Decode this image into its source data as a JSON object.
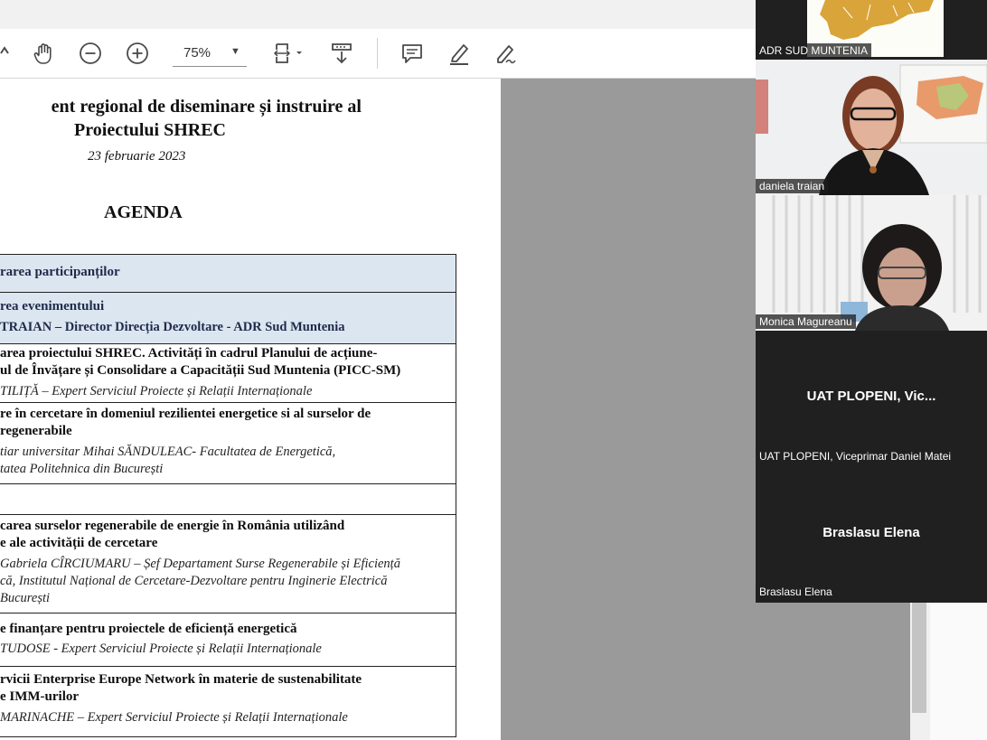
{
  "toolbar": {
    "zoom_value": "75%",
    "buttons": [
      "hand-tool-icon",
      "zoom-out-icon",
      "zoom-in-icon",
      "fit-page-icon",
      "download-icon",
      "comment-icon",
      "highlight-icon",
      "sign-icon"
    ]
  },
  "document": {
    "title_line1": "ent regional de diseminare și instruire al",
    "title_line2": "Proiectului SHREC",
    "date": "23 februarie 2023",
    "agenda_heading": "AGENDA",
    "rows": [
      {
        "title": "rarea participanților",
        "shaded": true
      },
      {
        "title": "rea evenimentului",
        "sub": "TRAIAN – Director Direcția Dezvoltare -  ADR Sud Muntenia",
        "shaded": true
      },
      {
        "title1": "area proiectului SHREC. Activități în cadrul Planului de acțiune-",
        "title2": "ul de Învățare și Consolidare a Capacității Sud Muntenia (PICC-SM)",
        "sub": "TILIȚĂ – Expert Serviciul Proiecte și Relații Internaționale"
      },
      {
        "title1": "re în cercetare în domeniul rezilientei energetice si al surselor de",
        "title2": "regenerabile",
        "sub1": "tiar  universitar  Mihai  SĂNDULEAC-  Facultatea  de  Energetică,",
        "sub2": "tatea Politehnica din București"
      },
      {
        "title": ""
      },
      {
        "title1": "carea  surselor  regenerabile  de  energie  în  România  utilizând",
        "title2": "e ale activității de cercetare",
        "sub1": "Gabriela CÎRCIUMARU – Șef Departament Surse Regenerabile și Eficiență",
        "sub2": "că, Institutul Național de Cercetare-Dezvoltare pentru Inginerie Electrică",
        "sub3": "București"
      },
      {
        "title": "e finanțare pentru proiectele de eficiență energetică",
        "sub": "TUDOSE - Expert Serviciul Proiecte și Relații Internaționale"
      },
      {
        "title1": "rvicii Enterprise Europe Network în materie de sustenabilitate",
        "title2": "e IMM-urilor",
        "sub": "MARINACHE – Expert Serviciul Proiecte și Relații Internaționale"
      }
    ]
  },
  "participants": [
    {
      "name": "ADR SUD MUNTENIA",
      "video": true
    },
    {
      "name": "daniela traian",
      "video": true
    },
    {
      "name": "Monica Magureanu",
      "video": true
    },
    {
      "name": "UAT PLOPENI, Viceprimar Daniel Matei",
      "display": "UAT PLOPENI, Vic...",
      "video": false
    },
    {
      "name": "Braslasu Elena",
      "display": "Braslasu Elena",
      "video": false
    }
  ],
  "colors": {
    "row_shade": "#dce6f1",
    "tile_dark": "#202020",
    "map_gold": "#d9a43a"
  }
}
